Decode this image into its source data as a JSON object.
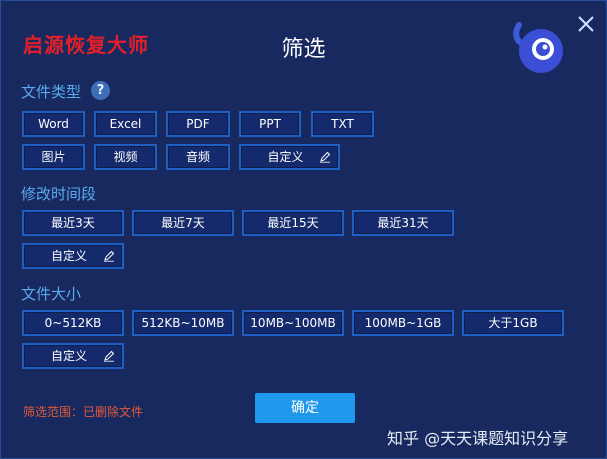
{
  "brand": "启源恢复大师",
  "title": "筛选",
  "icons": {
    "close": "close-icon",
    "mascot": "mascot-logo",
    "help": "help-icon",
    "edit": "pencil-icon"
  },
  "colors": {
    "background": "#17295f",
    "brand": "#e3202a",
    "section": "#5aaaf0",
    "button_border": "#1f5fc4",
    "confirm": "#1f97ea",
    "scope": "#e35b3a"
  },
  "file_type": {
    "label": "文件类型",
    "help": "?",
    "options": [
      "Word",
      "Excel",
      "PDF",
      "PPT",
      "TXT",
      "图片",
      "视频",
      "音频"
    ],
    "custom": "自定义"
  },
  "modified_time": {
    "label": "修改时间段",
    "options": [
      "最近3天",
      "最近7天",
      "最近15天",
      "最近31天"
    ],
    "custom": "自定义"
  },
  "file_size": {
    "label": "文件大小",
    "options": [
      "0~512KB",
      "512KB~10MB",
      "10MB~100MB",
      "100MB~1GB",
      "大于1GB"
    ],
    "custom": "自定义"
  },
  "footer": {
    "scope": "筛选范围：已删除文件",
    "confirm": "确定"
  },
  "watermark": "知乎 @天天课题知识分享"
}
